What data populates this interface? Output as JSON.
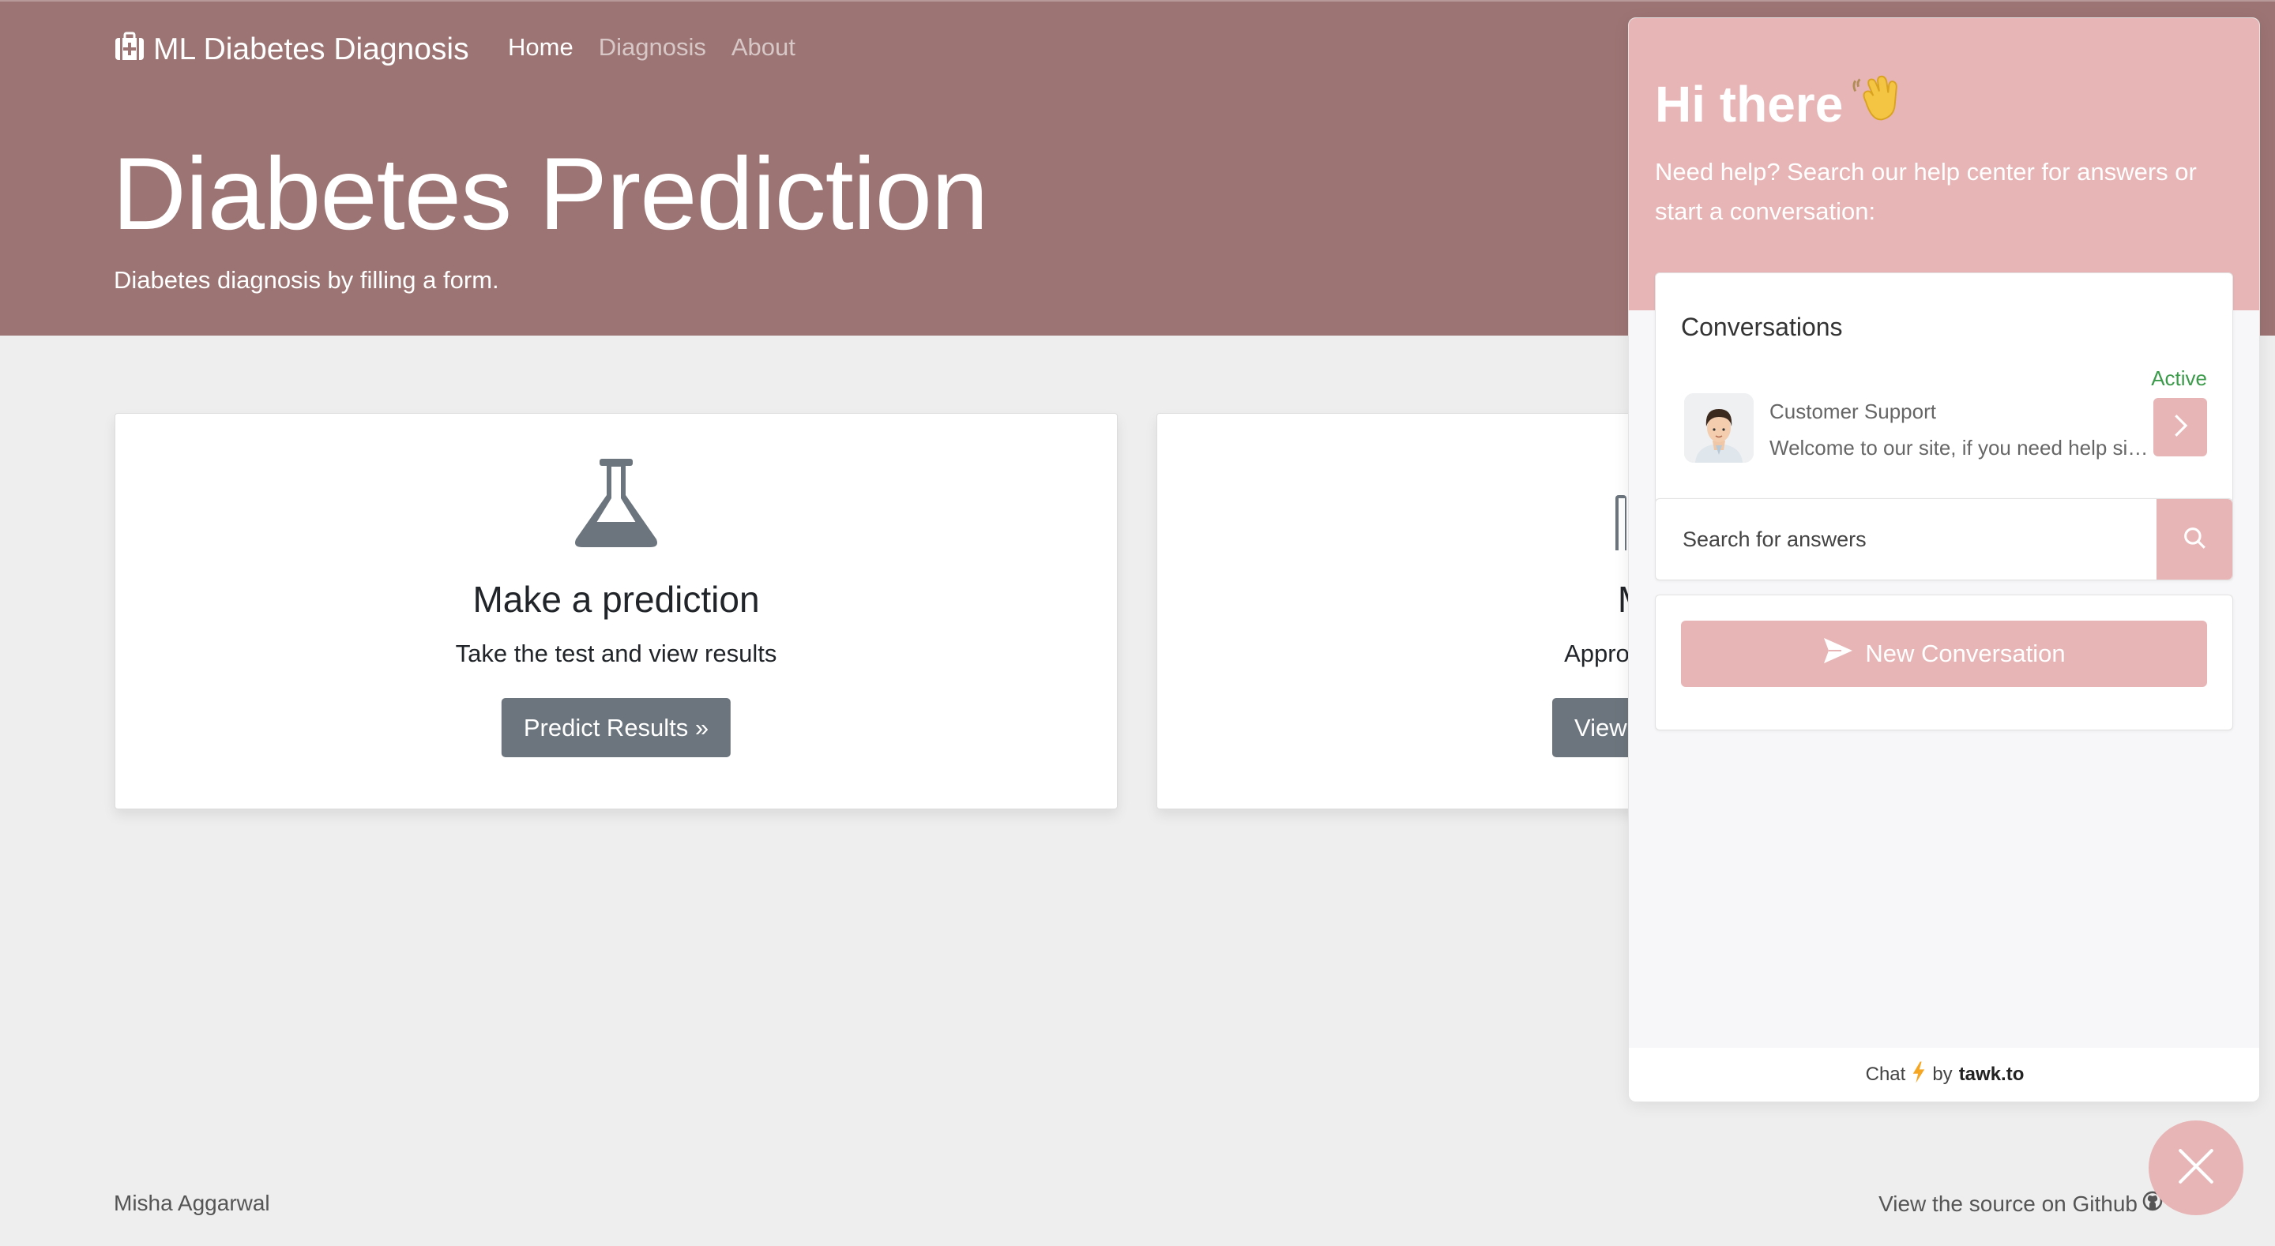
{
  "navbar": {
    "brand": "ML Diabetes Diagnosis",
    "brand_icon": "medkit-icon",
    "links": [
      {
        "label": "Home",
        "active": true
      },
      {
        "label": "Diagnosis",
        "active": false
      },
      {
        "label": "About",
        "active": false
      }
    ]
  },
  "hero": {
    "title": "Diabetes Prediction",
    "subtitle": "Diabetes diagnosis by filling a form."
  },
  "cards": [
    {
      "icon": "flask-icon",
      "title": "Make a prediction",
      "text": "Take the test and view results",
      "button": "Predict Results »"
    },
    {
      "icon": "clipboard-icon",
      "title": "Meth",
      "text": "Approach followe",
      "button": "View"
    }
  ],
  "footer": {
    "author": "Misha Aggarwal",
    "source_link": "View the source on Github",
    "source_icon": "github-icon"
  },
  "chat": {
    "greeting": "Hi there",
    "greeting_icon": "waving-hand-icon",
    "help_text": "Need help? Search our help center for answers or start a conversation:",
    "conversations_title": "Conversations",
    "status": "Active",
    "agent_name": "Customer Support",
    "last_message": "Welcome to our site, if you need help sim...",
    "search_placeholder": "Search for answers",
    "new_conversation": "New Conversation",
    "footer_prefix": "Chat",
    "footer_by": "by",
    "footer_brand": "tawk.to"
  },
  "colors": {
    "hero_bg": "#9c7473",
    "chat_accent": "#e8b5b6",
    "button_bg": "#6c757d",
    "active_green": "#3c9a4b"
  }
}
